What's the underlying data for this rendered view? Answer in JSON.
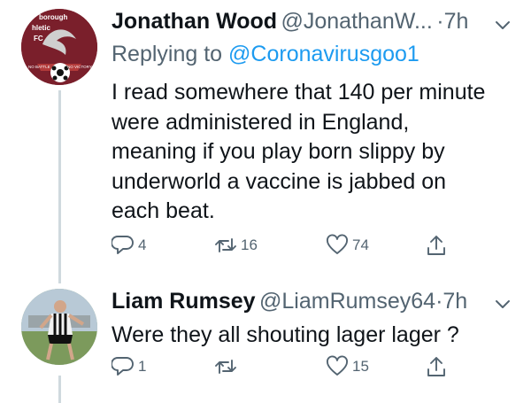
{
  "tweets": [
    {
      "display_name": "Jonathan Wood",
      "handle": "@JonathanW...",
      "separator": "·",
      "time": "7h",
      "reply_prefix": "Replying to",
      "reply_to": "@Coronavirusgoo1",
      "text_lines": [
        "I read somewhere that 140 per minute",
        "were administered in England,",
        "meaning if you play born slippy by",
        "underworld a vaccine is jabbed on",
        "each beat."
      ],
      "avatar": {
        "logo_text_top": "borough",
        "logo_text_mid": "hletic",
        "logo_text_fc": "FC",
        "logo_banner_left": "NO BATTLE",
        "logo_banner_right": "NO VICTORY",
        "bg_color": "#7a1f2b"
      },
      "actions": {
        "replies": "4",
        "retweets": "16",
        "likes": "74"
      }
    },
    {
      "display_name": "Liam Rumsey",
      "handle": "@LiamRumsey64",
      "separator": "·",
      "time": "7h",
      "text_lines": [
        "Were they all shouting lager lager ?"
      ],
      "avatar": {
        "bg_color": "#8fae7a"
      },
      "actions": {
        "replies": "1",
        "retweets": "",
        "likes": "15"
      }
    }
  ],
  "colors": {
    "text": "#0f1419",
    "secondary": "#536471",
    "link": "#1d9bf0",
    "thread_line": "#cfd9de"
  }
}
